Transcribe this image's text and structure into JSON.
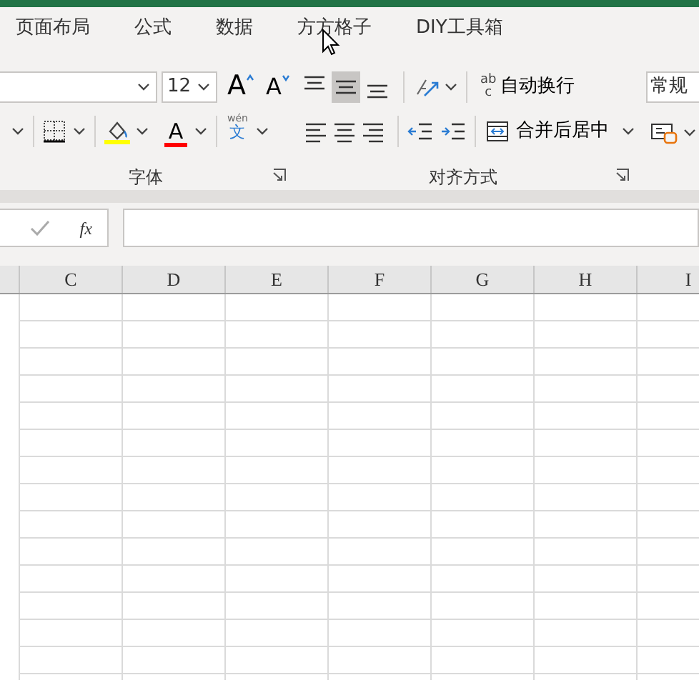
{
  "tabs": [
    {
      "label": "页面布局",
      "selected": false
    },
    {
      "label": "公式",
      "selected": false
    },
    {
      "label": "数据",
      "selected": false
    },
    {
      "label": "方方格子",
      "selected": false
    },
    {
      "label": "DIY工具箱",
      "selected": false
    }
  ],
  "font_group": {
    "label": "字体",
    "font_size": "12",
    "grow_glyph": "A",
    "shrink_glyph": "A",
    "font_color_glyph": "A",
    "phonetic_top": "wén",
    "phonetic_bottom": "文"
  },
  "alignment_group": {
    "label": "对齐方式",
    "row_1": [
      {
        "kind": "top",
        "selected": false
      },
      {
        "kind": "middle",
        "selected": true
      },
      {
        "kind": "bottom",
        "selected": false
      }
    ],
    "row_2": [
      {
        "kind": "left",
        "selected": false
      },
      {
        "kind": "center",
        "selected": false
      },
      {
        "kind": "right",
        "selected": false
      }
    ],
    "wrap_icon_text": "ab",
    "wrap_icon_text_2": "c",
    "wrap_text": "自动换行",
    "merge_center": "合并后居中"
  },
  "number_group": {
    "format": "常规"
  },
  "formula_bar": {
    "fx": "fx"
  },
  "columns": [
    "C",
    "D",
    "E",
    "F",
    "G",
    "H",
    "I"
  ]
}
